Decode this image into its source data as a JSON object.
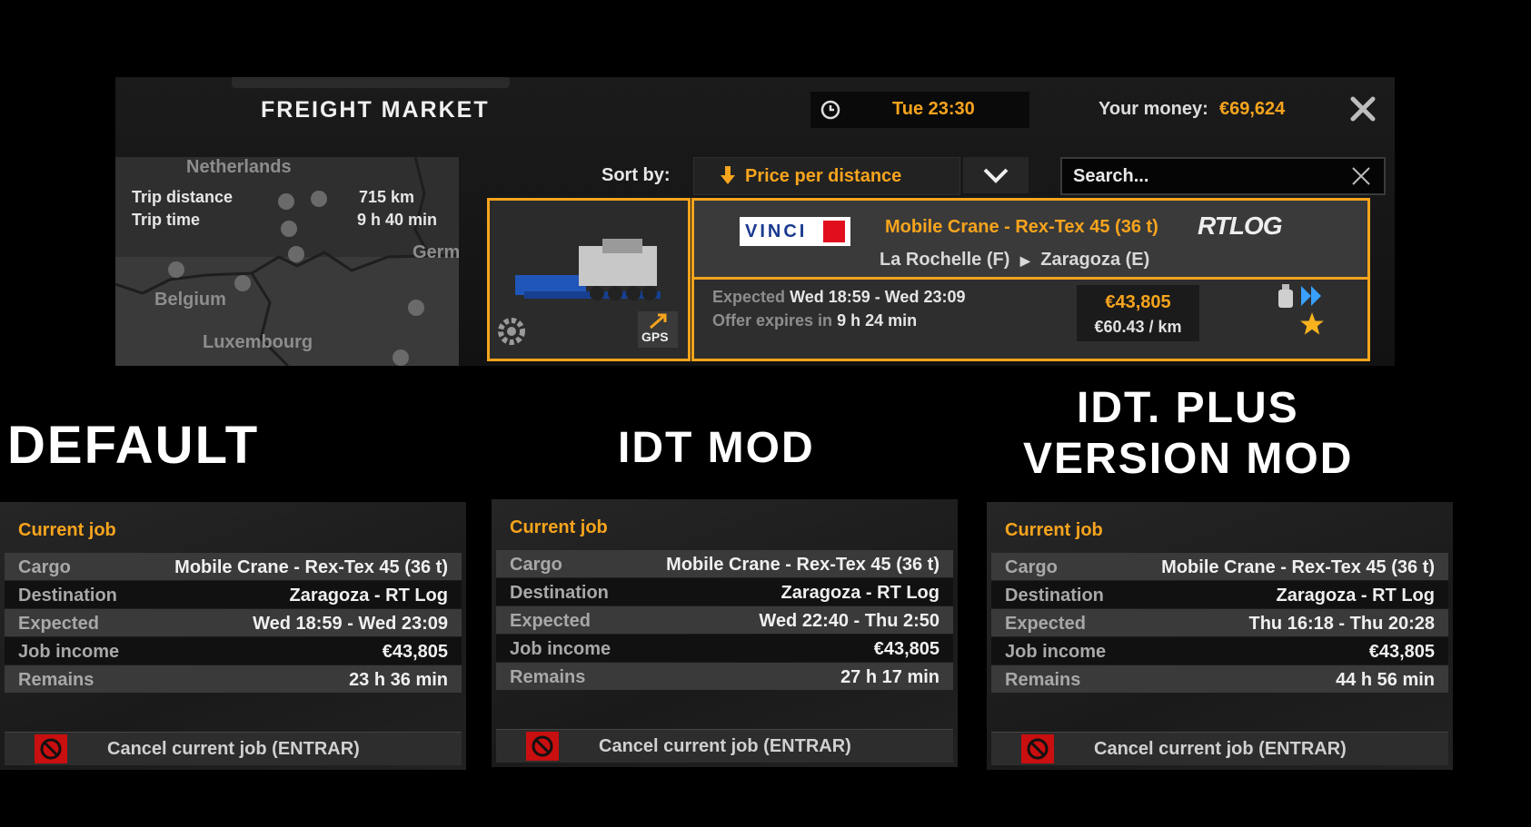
{
  "freight_market": {
    "title": "FREIGHT MARKET",
    "game_time": "Tue 23:30",
    "money_label": "Your money:",
    "money_value": "€69,624",
    "map": {
      "countries": [
        "Netherlands",
        "Germ",
        "Belgium",
        "Luxembourg"
      ],
      "trip_distance_label": "Trip distance",
      "trip_distance_value": "715 km",
      "trip_time_label": "Trip time",
      "trip_time_value": "9 h 40 min"
    },
    "sort_label": "Sort by:",
    "sort_value": "Price per distance",
    "search_placeholder": "Search...",
    "gps_label": "GPS",
    "job": {
      "company_logo_text": "VINCI",
      "cargo": "Mobile Crane - Rex-Tex 45 (36 t)",
      "destination_logo_text": "RTLOG",
      "route_from": "La Rochelle (F)",
      "route_to": "Zaragoza (E)",
      "expected_label": "Expected",
      "expected_value": "Wed 18:59 - Wed 23:09",
      "expires_label": "Offer expires in",
      "expires_value": "9 h 24 min",
      "price": "€43,805",
      "price_per_km": "€60.43 / km"
    }
  },
  "captions": {
    "default": "DEFAULT",
    "idt": "IDT MOD",
    "idt_plus_line1": "IDT. PLUS",
    "idt_plus_line2": "VERSION MOD"
  },
  "panels": [
    {
      "heading": "Current job",
      "rows": [
        {
          "key": "Cargo",
          "value": "Mobile Crane - Rex-Tex 45 (36 t)"
        },
        {
          "key": "Destination",
          "value": "Zaragoza - RT Log"
        },
        {
          "key": "Expected",
          "value": "Wed 18:59 - Wed 23:09"
        },
        {
          "key": "Job income",
          "value": "€43,805"
        },
        {
          "key": "Remains",
          "value": "23 h 36 min"
        }
      ],
      "cancel_label": "Cancel current job (ENTRAR)"
    },
    {
      "heading": "Current job",
      "rows": [
        {
          "key": "Cargo",
          "value": "Mobile Crane - Rex-Tex 45 (36 t)"
        },
        {
          "key": "Destination",
          "value": "Zaragoza - RT Log"
        },
        {
          "key": "Expected",
          "value": "Wed 22:40 - Thu 2:50"
        },
        {
          "key": "Job income",
          "value": "€43,805"
        },
        {
          "key": "Remains",
          "value": "27 h 17 min"
        }
      ],
      "cancel_label": "Cancel current job (ENTRAR)"
    },
    {
      "heading": "Current job",
      "rows": [
        {
          "key": "Cargo",
          "value": "Mobile Crane - Rex-Tex 45 (36 t)"
        },
        {
          "key": "Destination",
          "value": "Zaragoza - RT Log"
        },
        {
          "key": "Expected",
          "value": "Thu 16:18 - Thu 20:28"
        },
        {
          "key": "Job income",
          "value": "€43,805"
        },
        {
          "key": "Remains",
          "value": "44 h 56 min"
        }
      ],
      "cancel_label": "Cancel current job (ENTRAR)"
    }
  ],
  "colors": {
    "accent": "#f7a41d",
    "background": "#000000",
    "panel": "#202020",
    "cancel_icon": "#c90f0f"
  }
}
